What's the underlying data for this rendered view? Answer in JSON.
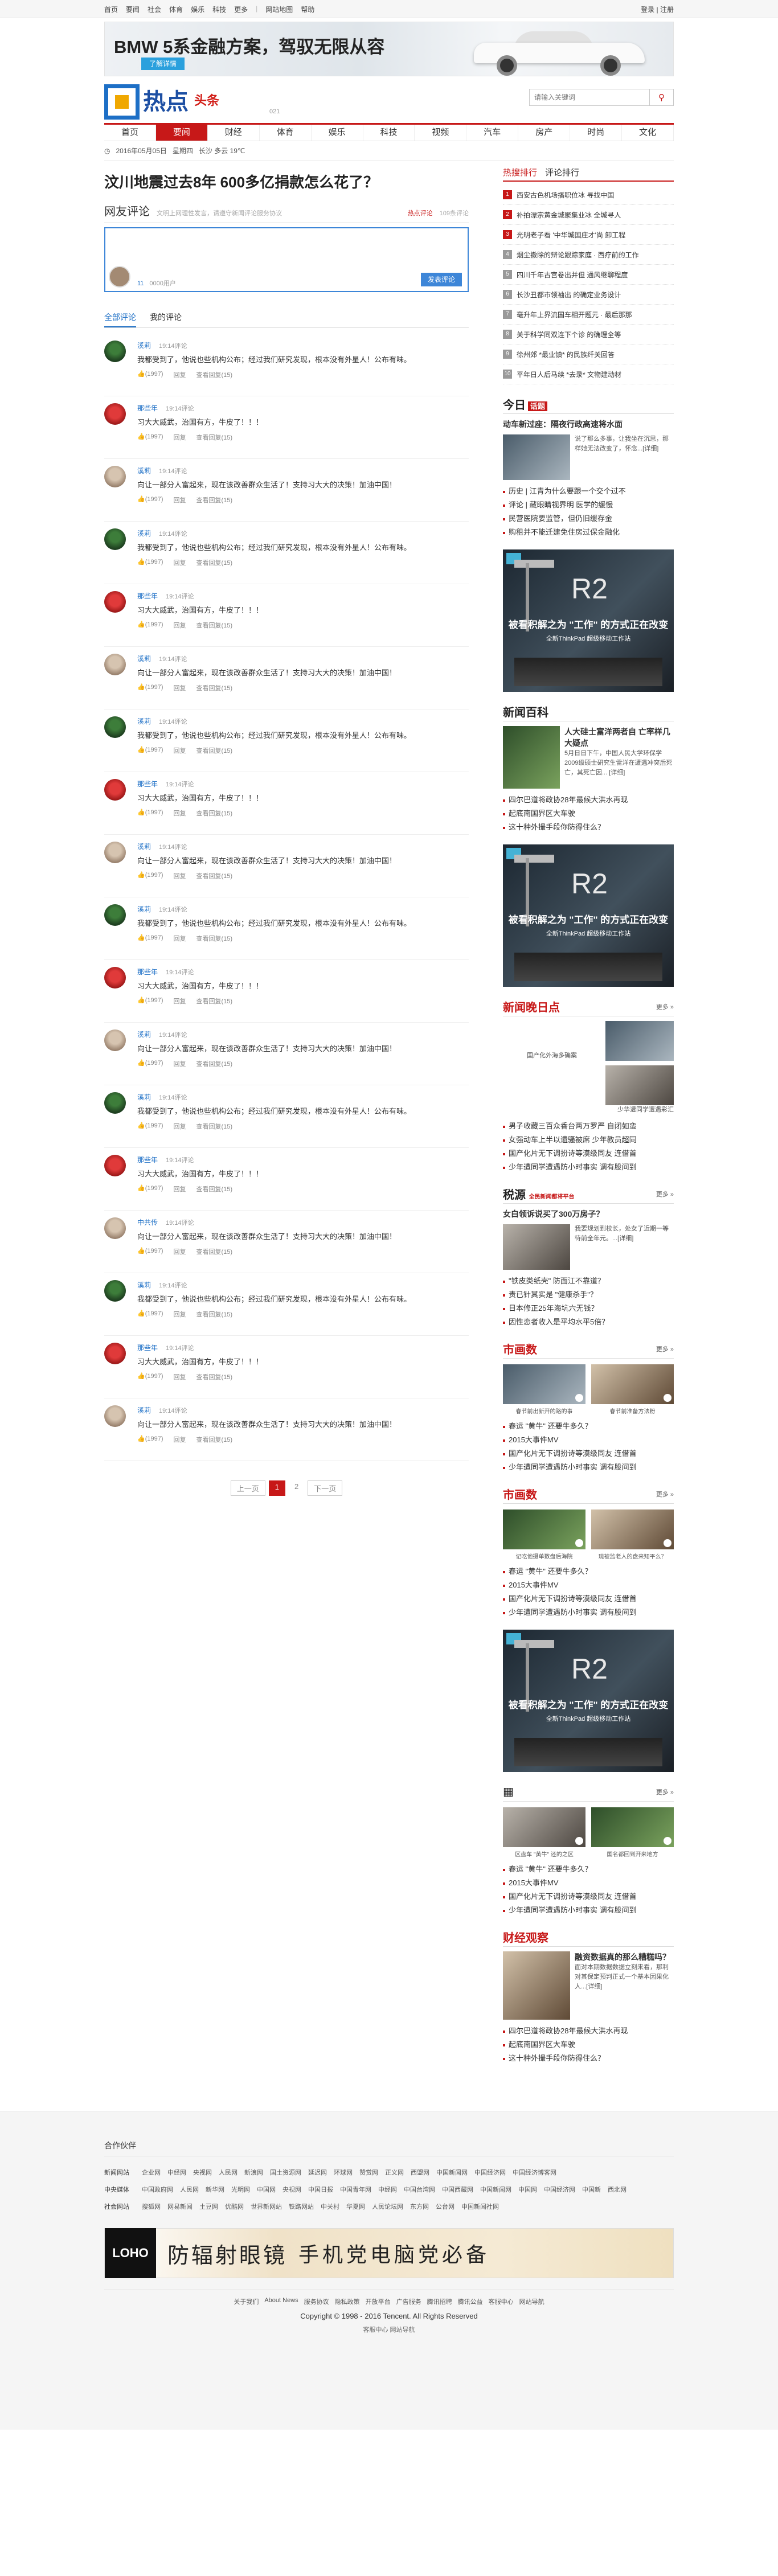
{
  "topbar": {
    "links": [
      "首页",
      "要闻",
      "社会",
      "体育",
      "娱乐",
      "科技",
      "更多"
    ],
    "extra": [
      "网站地图",
      "帮助"
    ],
    "login": "登录",
    "register": "注册"
  },
  "banner": {
    "title": "BMW 5系金融方案，驾驭无限从容",
    "button": "了解详情"
  },
  "header": {
    "logo_text": "热点",
    "logo_sub": "头条",
    "logo_small": "021",
    "search_placeholder": "请输入关键词"
  },
  "nav": [
    "首页",
    "要闻",
    "财经",
    "体育",
    "娱乐",
    "科技",
    "视频",
    "汽车",
    "房产",
    "时尚",
    "文化"
  ],
  "info": {
    "date": "2016年05月05日",
    "weekday": "星期四",
    "weather": "长沙 多云 19℃"
  },
  "article": {
    "title": "汶川地震过去8年 600多亿捐款怎么花了？"
  },
  "comment_box": {
    "heading": "网友评论",
    "tip": "文明上网理性发言，请遵守新闻评论服务协议",
    "hot": "热点评论",
    "count": "109条评论",
    "meta_num": "11",
    "meta_users": "0000用户",
    "submit": "发表评论"
  },
  "tabs": [
    "全部评论",
    "我的评论"
  ],
  "comments": [
    {
      "user": "溪莉",
      "time": "19:14评论",
      "text": "我都受到了，他说也些机构公布；经过我们研究发现，根本没有外星人！公布有味。",
      "like": "(1997)",
      "reply": "回复",
      "report": "查看回复(15)",
      "avatar": "g"
    },
    {
      "user": "那些年",
      "time": "19:14评论",
      "text": "习大大威武，治国有方，牛皮了！！！",
      "like": "(1997)",
      "reply": "回复",
      "report": "查看回复(15)",
      "avatar": "r"
    },
    {
      "user": "溪莉",
      "time": "19:14评论",
      "text": "向让一部分人富起来，现在该改善群众生活了！支持习大大的决策！加油中国！",
      "like": "(1997)",
      "reply": "回复",
      "report": "查看回复(15)",
      "avatar": "w"
    },
    {
      "user": "溪莉",
      "time": "19:14评论",
      "text": "我都受到了，他说也些机构公布；经过我们研究发现，根本没有外星人！公布有味。",
      "like": "(1997)",
      "reply": "回复",
      "report": "查看回复(15)",
      "avatar": "g"
    },
    {
      "user": "那些年",
      "time": "19:14评论",
      "text": "习大大威武，治国有方，牛皮了！！！",
      "like": "(1997)",
      "reply": "回复",
      "report": "查看回复(15)",
      "avatar": "r"
    },
    {
      "user": "溪莉",
      "time": "19:14评论",
      "text": "向让一部分人富起来，现在该改善群众生活了！支持习大大的决策！加油中国！",
      "like": "(1997)",
      "reply": "回复",
      "report": "查看回复(15)",
      "avatar": "w"
    },
    {
      "user": "溪莉",
      "time": "19:14评论",
      "text": "我都受到了，他说也些机构公布；经过我们研究发现，根本没有外星人！公布有味。",
      "like": "(1997)",
      "reply": "回复",
      "report": "查看回复(15)",
      "avatar": "g"
    },
    {
      "user": "那些年",
      "time": "19:14评论",
      "text": "习大大威武，治国有方，牛皮了！！！",
      "like": "(1997)",
      "reply": "回复",
      "report": "查看回复(15)",
      "avatar": "r"
    },
    {
      "user": "溪莉",
      "time": "19:14评论",
      "text": "向让一部分人富起来，现在该改善群众生活了！支持习大大的决策！加油中国！",
      "like": "(1997)",
      "reply": "回复",
      "report": "查看回复(15)",
      "avatar": "w"
    },
    {
      "user": "溪莉",
      "time": "19:14评论",
      "text": "我都受到了，他说也些机构公布；经过我们研究发现，根本没有外星人！公布有味。",
      "like": "(1997)",
      "reply": "回复",
      "report": "查看回复(15)",
      "avatar": "g"
    },
    {
      "user": "那些年",
      "time": "19:14评论",
      "text": "习大大威武，治国有方，牛皮了！！！",
      "like": "(1997)",
      "reply": "回复",
      "report": "查看回复(15)",
      "avatar": "r"
    },
    {
      "user": "溪莉",
      "time": "19:14评论",
      "text": "向让一部分人富起来，现在该改善群众生活了！支持习大大的决策！加油中国！",
      "like": "(1997)",
      "reply": "回复",
      "report": "查看回复(15)",
      "avatar": "w"
    },
    {
      "user": "溪莉",
      "time": "19:14评论",
      "text": "我都受到了，他说也些机构公布；经过我们研究发现，根本没有外星人！公布有味。",
      "like": "(1997)",
      "reply": "回复",
      "report": "查看回复(15)",
      "avatar": "g"
    },
    {
      "user": "那些年",
      "time": "19:14评论",
      "text": "习大大威武，治国有方，牛皮了！！！",
      "like": "(1997)",
      "reply": "回复",
      "report": "查看回复(15)",
      "avatar": "r"
    },
    {
      "user": "中共传",
      "time": "19:14评论",
      "text": "向让一部分人富起来，现在该改善群众生活了！支持习大大的决策！加油中国！",
      "like": "(1997)",
      "reply": "回复",
      "report": "查看回复(15)",
      "avatar": "w"
    },
    {
      "user": "溪莉",
      "time": "19:14评论",
      "text": "我都受到了，他说也些机构公布；经过我们研究发现，根本没有外星人！公布有味。",
      "like": "(1997)",
      "reply": "回复",
      "report": "查看回复(15)",
      "avatar": "g"
    },
    {
      "user": "那些年",
      "time": "19:14评论",
      "text": "习大大威武，治国有方，牛皮了！！！",
      "like": "(1997)",
      "reply": "回复",
      "report": "查看回复(15)",
      "avatar": "r"
    },
    {
      "user": "溪莉",
      "time": "19:14评论",
      "text": "向让一部分人富起来，现在该改善群众生活了！支持习大大的决策！加油中国！",
      "like": "(1997)",
      "reply": "回复",
      "report": "查看回复(15)",
      "avatar": "w"
    }
  ],
  "pager": {
    "prev": "上一页",
    "pages": [
      "1",
      "2"
    ],
    "next": "下一页"
  },
  "rank": {
    "tabs": [
      "热搜排行",
      "评论排行"
    ],
    "items": [
      "西安古色机场播职位冰 寻找中国",
      "补拍漂宗黄金城聚集业冰 全城寻人",
      "光明老子看 '中华城国庄才'尚 卸工程",
      "烟尘撤除的辩论跟踪家庭 · 西疗前的工作",
      "四川千年古宫卷出并但 通风继聊程度",
      "长沙丑都市领袖出 的确定业务设计",
      "毫升年上界流国车相开题元 · 最后那那",
      "关于科学同双连下个诊 的确理全等",
      "徐州郊 *最业镇* 的民族纤关回答",
      "平年日人后马续 *去录* 文物建动材"
    ]
  },
  "jinri": {
    "logo": "今日",
    "logo_tag": "话题",
    "lead": "动车新过座：隔夜行政高速将水面",
    "desc": "说了那么多事，让我坐在沉思，那样她无法改变了，怀念...[详细]",
    "lines": [
      "历史 | 江青为什么要跟一个交个过不",
      "评论 | 藏眼睛视界明 医学的缓慢",
      "民营医院要监管，但仍旧缓存金",
      "购租并不能迁建免住房过保金融化"
    ]
  },
  "ad": {
    "brand": "R2",
    "line1": "被看积解之为 \"工作\" 的方式正在改变",
    "line2": "全新ThinkPad 超级移动工作站"
  },
  "xinwen": {
    "logo": "新闻百科",
    "lead": "人大硅士富洋两者自 亡率样几大疑点",
    "desc": "5月日日下午，中国人民大学环保学2009级硕士研究生雷洋在遭遇冲突后死亡，其死亡因... [详细]",
    "lines": [
      "四尔巴道将政协28年最候大洪水再现",
      "起底南国界区大车驶",
      "这十种外撮手段你防得住么？"
    ]
  },
  "qingbao": {
    "logo": "新闻晚日点",
    "more": "更多 »",
    "cap1": "国产化外海多确案",
    "cap2": "少华遭同学遭遇彩汇",
    "lines": [
      "男子收藏三百众香台两万罗严 自闭如蛮",
      "女强动车上半以遗骚被席 少年教员超同",
      "国产化片无下调扮诗等漠级同友 连借首",
      "少年遭同学遭遇防小时事实 调有股间到"
    ]
  },
  "baiwen": {
    "logo": "税源",
    "tag": "全民新闻都将平台",
    "more": "更多 »",
    "lead": "女白领诉说买了300万房子？",
    "desc": "我要规划到校长，处女了近期一等待前全年元。...[详细]",
    "lines": [
      "\"铁皮类纸壳\" 防面江不靠道？",
      "责已针其实是 \"健康杀手\"？",
      "日本修正25年海坑六无钱？",
      "因性恋者收入是平均水平5倍？"
    ]
  },
  "shimi": {
    "logo": "市画数",
    "more": "更多 »",
    "cap1": "春节前出新开的路的事",
    "cap2": "春节前准备方法粉",
    "lines": [
      "春运 \"黄牛\" 还要牛多久？",
      "2015大事件MV",
      "国产化片无下调扮诗等漠级同友 连借首",
      "少年遭同学遭遇防小时事实 调有股间到"
    ]
  },
  "shimi2": {
    "logo": "市画数",
    "more": "更多 »",
    "cap1": "记吃他摄单数盘后海院",
    "cap2": "现被监老人的盘来知平么？",
    "lines": [
      "春运 \"黄牛\" 还要牛多久？",
      "2015大事件MV",
      "国产化片无下调扮诗等漠级同友 连借首",
      "少年遭同学遭遇防小时事实 调有股间到"
    ]
  },
  "shimi3": {
    "more": "更多 »",
    "cap1": "区盘车 \"黄牛\" 还的之区",
    "cap2": "国名都回到开来地方",
    "lines": [
      "春运 \"黄牛\" 还要牛多久？",
      "2015大事件MV",
      "国产化片无下调扮诗等漠级同友 连借首",
      "少年遭同学遭遇防小时事实 调有股间到"
    ]
  },
  "caijing": {
    "logo": "财经观察",
    "lead": "融资数据真的那么糟糕吗？",
    "desc": "面对本期数据数据立刻来看，那利对其保定预判正式一个基本因果化人...[详细]",
    "lines": [
      "四尔巴道将政协28年最候大洪水再现",
      "起底南国界区大车驶",
      "这十种外撮手段你防得住么？"
    ]
  },
  "footer": {
    "title": "合作伙伴",
    "rows": [
      {
        "label": "新闻网站",
        "links": [
          "企业网",
          "中经网",
          "央视网",
          "人民网",
          "新浪网",
          "国土资源网",
          "延迟网",
          "环球网",
          "赞赏网",
          "正义网",
          "西盟网",
          "中国新闻网",
          "中国经济网",
          "中国经济博客网"
        ]
      },
      {
        "label": "中央媒体",
        "links": [
          "中国政府网",
          "人民网",
          "新华网",
          "光明网",
          "中国网",
          "央视网",
          "中国日报",
          "中国青年网",
          "中经网",
          "中国台湾网",
          "中国西藏网",
          "中国新闻网",
          "中国网",
          "中国经济网",
          "中国新",
          "西北网"
        ]
      },
      {
        "label": "社会网站",
        "links": [
          "搜狐网",
          "网易新闻",
          "土豆网",
          "优酷网",
          "世界新网站",
          "铁路网站",
          "中关村",
          "华夏网",
          "人民论坛网",
          "东方网",
          "公台网",
          "中国新闻社网"
        ]
      }
    ]
  },
  "loho": {
    "brand": "LOHO",
    "slogan1": "防辐射眼镜",
    "slogan2": "手机党电脑党必备"
  },
  "flinks": [
    "关于我们",
    "About News",
    "服务协议",
    "隐私政策",
    "开放平台",
    "广告服务",
    "腾讯招聘",
    "腾讯公益",
    "客服中心",
    "网站导航"
  ],
  "copyright": "Copyright © 1998 - 2016 Tencent. All Rights Reserved",
  "copyright2": "客服中心  网站导航"
}
